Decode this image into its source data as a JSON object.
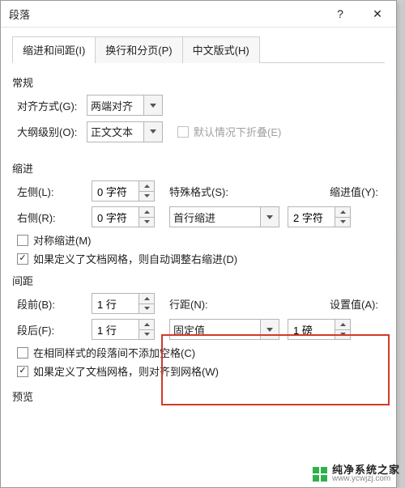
{
  "dialog": {
    "title": "段落",
    "help_btn": "?",
    "close_btn": "✕"
  },
  "tabs": [
    {
      "label": "缩进和间距(I)",
      "active": true
    },
    {
      "label": "换行和分页(P)",
      "active": false
    },
    {
      "label": "中文版式(H)",
      "active": false
    }
  ],
  "sections": {
    "general": "常规",
    "indent": "缩进",
    "spacing": "间距",
    "preview": "预览"
  },
  "general": {
    "align_label": "对齐方式(G):",
    "align_value": "两端对齐",
    "outline_label": "大纲级别(O):",
    "outline_value": "正文文本",
    "collapse_label": "默认情况下折叠(E)"
  },
  "indent": {
    "left_label": "左侧(L):",
    "left_value": "0 字符",
    "right_label": "右侧(R):",
    "right_value": "0 字符",
    "special_label": "特殊格式(S):",
    "special_value": "首行缩进",
    "by_label": "缩进值(Y):",
    "by_value": "2 字符",
    "mirror_label": "对称缩进(M)",
    "autogrid_label": "如果定义了文档网格，则自动调整右缩进(D)"
  },
  "spacing": {
    "before_label": "段前(B):",
    "before_value": "1 行",
    "after_label": "段后(F):",
    "after_value": "1 行",
    "line_label": "行距(N):",
    "line_value": "固定值",
    "at_label": "设置值(A):",
    "at_value": "1 磅",
    "nospace_label": "在相同样式的段落间不添加空格(C)",
    "snapgrid_label": "如果定义了文档网格，则对齐到网格(W)"
  },
  "watermark": {
    "name": "纯净系统之家",
    "url": "www.ycwjzj.com"
  }
}
